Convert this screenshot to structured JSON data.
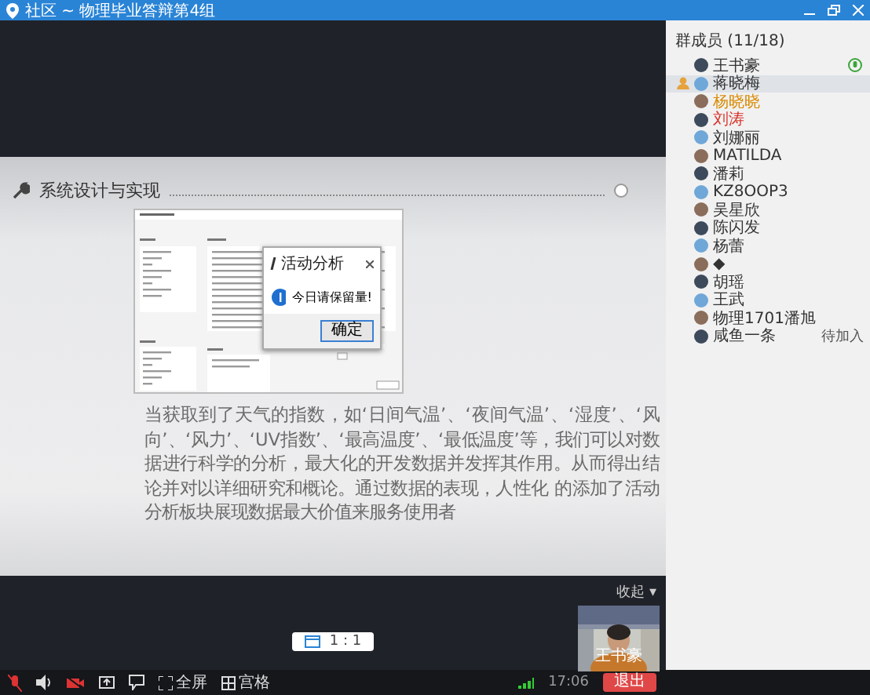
{
  "window": {
    "title": "社区 ~ 物理毕业答辩第4组"
  },
  "members": {
    "header": "群成员 (11/18)",
    "items": [
      {
        "name": "王书豪",
        "color": "#333333",
        "selected": false,
        "speaking": true,
        "host": false
      },
      {
        "name": "蒋晓梅",
        "color": "#333333",
        "selected": true,
        "speaking": false,
        "host": true
      },
      {
        "name": "杨晓晓",
        "color": "#d98a00",
        "selected": false,
        "speaking": false,
        "host": false
      },
      {
        "name": "刘涛",
        "color": "#d9342b",
        "selected": false,
        "speaking": false,
        "host": false
      },
      {
        "name": "刘娜丽",
        "color": "#333333",
        "selected": false,
        "speaking": false,
        "host": false
      },
      {
        "name": "MATILDA",
        "color": "#333333",
        "selected": false,
        "speaking": false,
        "host": false
      },
      {
        "name": "潘莉",
        "color": "#333333",
        "selected": false,
        "speaking": false,
        "host": false
      },
      {
        "name": "KZ8OOP3",
        "color": "#333333",
        "selected": false,
        "speaking": false,
        "host": false
      },
      {
        "name": "吴星欣",
        "color": "#333333",
        "selected": false,
        "speaking": false,
        "host": false
      },
      {
        "name": "陈闪发",
        "color": "#333333",
        "selected": false,
        "speaking": false,
        "host": false
      },
      {
        "name": "杨蕾",
        "color": "#333333",
        "selected": false,
        "speaking": false,
        "host": false
      },
      {
        "name": "◆",
        "color": "#333333",
        "selected": false,
        "speaking": false,
        "host": false
      },
      {
        "name": "胡瑶",
        "color": "#333333",
        "selected": false,
        "speaking": false,
        "host": false
      },
      {
        "name": "王武",
        "color": "#333333",
        "selected": false,
        "speaking": false,
        "host": false
      },
      {
        "name": "物理1701潘旭",
        "color": "#333333",
        "selected": false,
        "speaking": false,
        "host": false
      },
      {
        "name": "咸鱼一条",
        "color": "#333333",
        "selected": false,
        "speaking": false,
        "host": false,
        "status": "待加入"
      }
    ]
  },
  "slide": {
    "title": "系统设计与实现",
    "dialog": {
      "title": "活动分析",
      "message": "今日请保留量!",
      "button": "确定"
    },
    "body": "当获取到了天气的指数，如‘日间气温’、‘夜间气温’、‘湿度’、‘风向’、‘风力’、‘UV指数’、‘最高温度’、‘最低温度’等，我们可以对数据进行科学的分析，最大化的开发数据并发挥其作用。从而得出结论并对以详细研究和概论。通过数据的表现，人性化 的添加了活动分析板块展现数据最大价值来服务使用者"
  },
  "pager": {
    "label": "1 : 1"
  },
  "video": {
    "collapse": "收起 ▾",
    "name": "王书豪"
  },
  "toolbar": {
    "fullscreen": "全屏",
    "grid": "宫格",
    "time": "17:06",
    "exit": "退出"
  }
}
